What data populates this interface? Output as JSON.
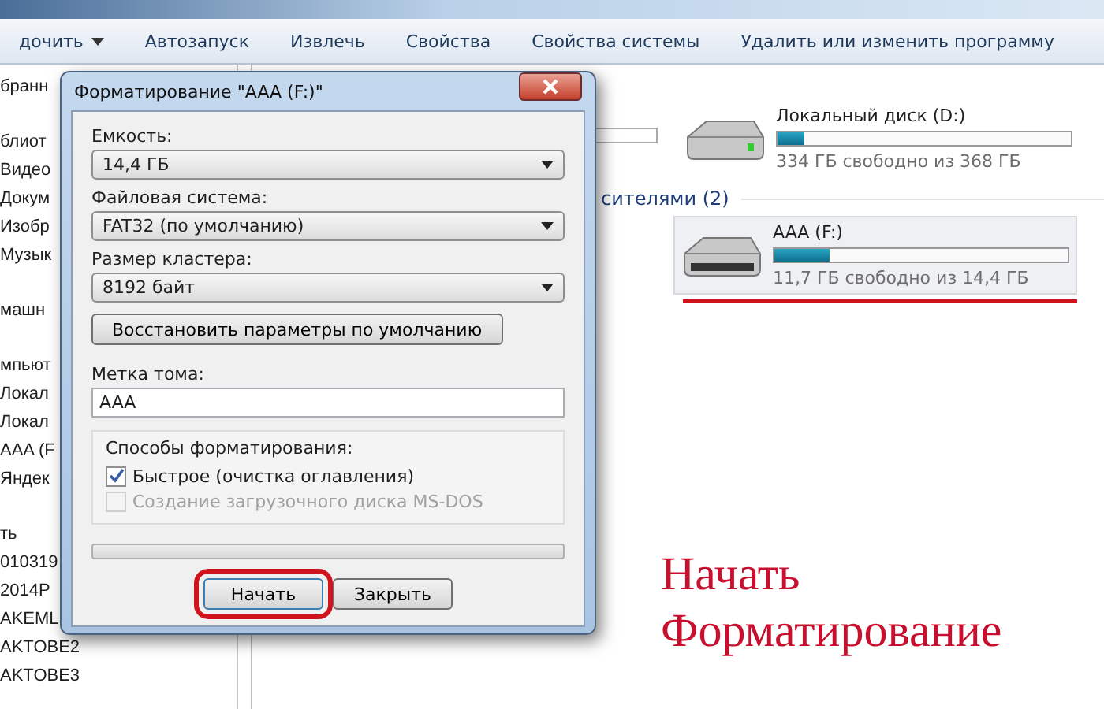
{
  "toolbar": {
    "items": [
      {
        "label": "дочить",
        "has_caret": true
      },
      {
        "label": "Автозапуск",
        "has_caret": false
      },
      {
        "label": "Извлечь",
        "has_caret": false
      },
      {
        "label": "Свойства",
        "has_caret": false
      },
      {
        "label": "Свойства системы",
        "has_caret": false
      },
      {
        "label": "Удалить или изменить программу",
        "has_caret": false
      }
    ]
  },
  "sidebar": {
    "groups": [
      {
        "items": [
          "бранн"
        ]
      },
      {
        "items": [
          "блиот",
          "Видео",
          "Докум",
          "Изобр",
          "Музык"
        ]
      },
      {
        "items": [
          "машн"
        ]
      },
      {
        "items": [
          "мпьют",
          "Локал",
          "Локал",
          "AAA (F",
          "Яндек"
        ]
      },
      {
        "items": [
          "ть",
          "010319",
          "2014P",
          "AKEML",
          "AKTOBE2",
          "AKTOBE3"
        ]
      }
    ]
  },
  "content": {
    "section_heading": "сителями (2)",
    "drives": [
      {
        "name": "Локальный диск (D:)",
        "free": "334 ГБ свободно из 368 ГБ",
        "level": 0.09,
        "selected": false,
        "kind": "hdd"
      },
      {
        "name": "AAA (F:)",
        "free": "11,7 ГБ свободно из 14,4 ГБ",
        "level": 0.19,
        "selected": true,
        "kind": "removable"
      }
    ]
  },
  "dialog": {
    "title": "Форматирование \"AAA (F:)\"",
    "capacity": {
      "label": "Емкость:",
      "value": "14,4 ГБ"
    },
    "filesystem": {
      "label": "Файловая система:",
      "value": "FAT32 (по умолчанию)"
    },
    "cluster": {
      "label": "Размер кластера:",
      "value": "8192 байт"
    },
    "restore_button": "Восстановить параметры по умолчанию",
    "volume_label": {
      "label": "Метка тома:",
      "value": "AAA"
    },
    "options": {
      "label": "Способы форматирования:",
      "items": [
        {
          "label": "Быстрое (очистка оглавления)",
          "checked": true,
          "disabled": false
        },
        {
          "label": "Создание загрузочного диска MS-DOS",
          "checked": false,
          "disabled": true
        }
      ]
    },
    "progress": {
      "level": 0
    },
    "buttons": [
      {
        "label": "Начать",
        "highlighted": true
      },
      {
        "label": "Закрыть",
        "highlighted": false
      }
    ]
  },
  "annotation": {
    "lines": [
      "Начать",
      "Форматирование"
    ]
  }
}
